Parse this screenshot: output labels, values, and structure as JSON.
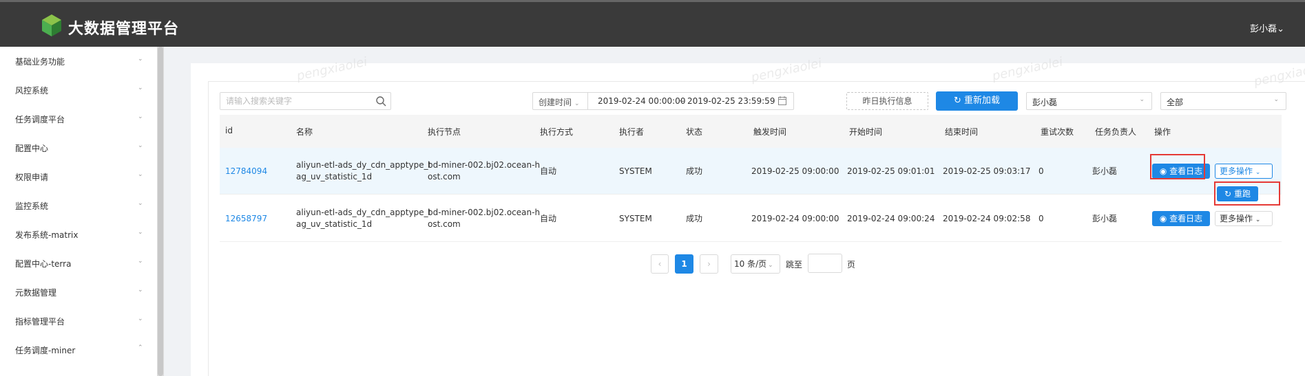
{
  "header": {
    "brand": "大数据管理平台",
    "user_menu": "彭小磊"
  },
  "sidebar": {
    "items": [
      {
        "label": "基础业务功能",
        "expanded": false
      },
      {
        "label": "风控系统",
        "expanded": false
      },
      {
        "label": "任务调度平台",
        "expanded": false
      },
      {
        "label": "配置中心",
        "expanded": false
      },
      {
        "label": "权限申请",
        "expanded": false
      },
      {
        "label": "监控系统",
        "expanded": false
      },
      {
        "label": "发布系统-matrix",
        "expanded": false
      },
      {
        "label": "配置中心-terra",
        "expanded": false
      },
      {
        "label": "元数据管理",
        "expanded": false
      },
      {
        "label": "指标管理平台",
        "expanded": false
      },
      {
        "label": "任务调度-miner",
        "expanded": true
      }
    ]
  },
  "watermark": {
    "text": "pengxiaolei"
  },
  "filters": {
    "search_placeholder": "请输入搜索关键字",
    "date_type": "创建时间",
    "date_start": "2019-02-24 00:00:00",
    "date_sep": "~",
    "date_end": "2019-02-25 23:59:59",
    "yesterday_btn": "昨日执行信息",
    "reload_btn": "重新加载",
    "owner_select": "彭小磊",
    "status_select": "全部"
  },
  "table": {
    "columns": [
      "id",
      "名称",
      "执行节点",
      "执行方式",
      "执行者",
      "状态",
      "触发时间",
      "开始时间",
      "结束时间",
      "重试次数",
      "任务负责人",
      "操作"
    ],
    "rows": [
      {
        "id": "12784094",
        "name_l1": "aliyun-etl-ads_dy_cdn_apptype_t",
        "name_l2": "ag_uv_statistic_1d",
        "node_l1": "bd-miner-002.bj02.ocean-h",
        "node_l2": "ost.com",
        "mode": "自动",
        "executor": "SYSTEM",
        "status": "成功",
        "trigger": "2019-02-25 09:00:00",
        "start": "2019-02-25 09:01:01",
        "end": "2019-02-25 09:03:17",
        "retries": "0",
        "owner": "彭小磊",
        "log_btn": "查看日志",
        "more_btn": "更多操作"
      },
      {
        "id": "12658797",
        "name_l1": "aliyun-etl-ads_dy_cdn_apptype_t",
        "name_l2": "ag_uv_statistic_1d",
        "node_l1": "bd-miner-002.bj02.ocean-h",
        "node_l2": "ost.com",
        "mode": "自动",
        "executor": "SYSTEM",
        "status": "成功",
        "trigger": "2019-02-24 09:00:00",
        "start": "2019-02-24 09:00:24",
        "end": "2019-02-24 09:02:58",
        "retries": "0",
        "owner": "彭小磊",
        "log_btn": "查看日志",
        "more_btn": "更多操作"
      }
    ],
    "dropdown_item": "重跑"
  },
  "pagination": {
    "prev": "‹",
    "current": "1",
    "next": "›",
    "page_size": "10 条/页",
    "goto_label": "跳至",
    "page_unit": "页"
  },
  "colors": {
    "primary": "#1e88e5",
    "header_bg": "#3a3a3a",
    "highlight": "#e53935"
  }
}
